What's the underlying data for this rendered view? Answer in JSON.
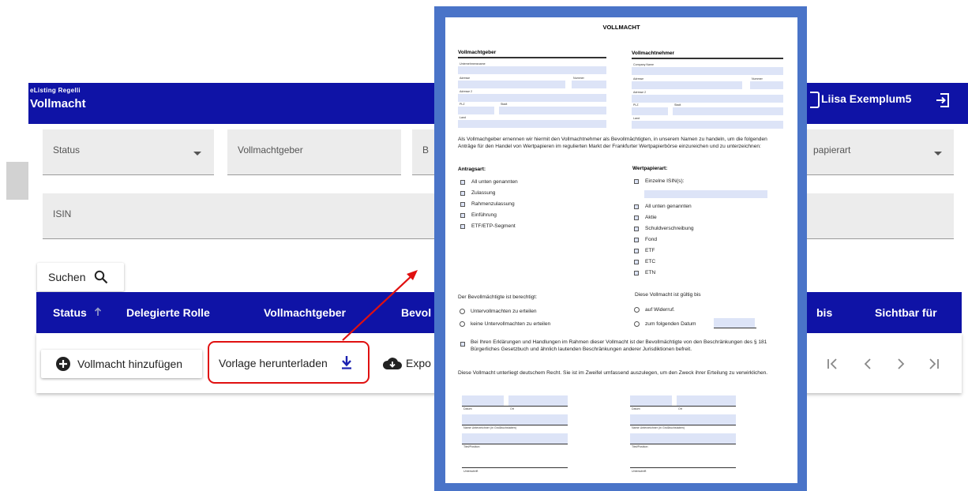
{
  "app": {
    "name": "eListing Regelli",
    "title": "Vollmacht",
    "user": "Liisa Exemplum5"
  },
  "filters": {
    "status": "Status",
    "vollmachtgeber": "Vollmachtgeber",
    "partial_b": "B",
    "wertpapierart_partial": "papierart",
    "isin": "ISIN",
    "search_label": "Suchen"
  },
  "table": {
    "columns": [
      "Status",
      "Delegierte Rolle",
      "Vollmachtgeber",
      "Bevol",
      "bis",
      "Sichtbar für"
    ]
  },
  "actions": {
    "add": "Vollmacht hinzufügen",
    "download": "Vorlage herunterladen",
    "export": "Expo"
  },
  "doc": {
    "title": "VOLLMACHT",
    "giver_heading": "Vollmachtgeber",
    "taker_heading": "Vollmachtnehmer",
    "giver_fields": {
      "company": "Unternehmensname",
      "address": "Adresse",
      "number": "Nummer",
      "address2": "Adresse 2",
      "zip": "PLZ",
      "city": "Stadt",
      "country": "Land"
    },
    "taker_fields": {
      "company": "Company Name",
      "address": "Adresse",
      "number": "Nummer",
      "address2": "Adresse 2",
      "zip": "PLZ",
      "city": "Stadt",
      "country": "Land"
    },
    "intro": "Als Vollmachgeber ernennen wir hiermit den Vollmachtnehmer als Bevollmächtigten, in unserem Namen zu handeln, um die folgenden Anträge für den Handel von Wertpapieren im regulierten Markt der Frankfurter Wertpapierbörse einzureichen und zu unterzeichnen:",
    "antragsart_heading": "Antragsart:",
    "antragsart_items": [
      "All unten genannten",
      "Zulassung",
      "Rahmenzulassung",
      "Einführung",
      "ETF/ETP-Segment"
    ],
    "wertpapierart_heading": "Wertpapierart:",
    "isin_item": "Einzelne ISIN(s):",
    "wertpapierart_items": [
      "All unten genannten",
      "Aktie",
      "Schuldverschreibung",
      "Fond",
      "ETF",
      "ETC",
      "ETN"
    ],
    "berechtigt_heading": "Der Bevollmächtigte ist berechtigt:",
    "berechtigt_items": [
      "Untervollmachten zu erteilen",
      "keine Untervollmachten zu erteilen"
    ],
    "gueltig_heading": "Diese Vollmacht ist gültig bis",
    "gueltig_items": [
      "auf Widerruf.",
      "zum folgenden Datum"
    ],
    "consent": "Bei Ihren Erklärungen und Handlungen im Rahmen dieser Vollmacht ist der Bevollmächtigte von den Beschränkungen des § 181 Bürgerliches Gesetzbuch und ähnlich lautenden Beschränkungen anderer Jurisdiktionen befreit.",
    "law": "Diese Vollmacht unterliegt deutschem Recht. Sie ist im Zweifel umfassend auszulegen, um den Zweck ihrer Erteilung zu verwirklichen.",
    "sig": {
      "date": "Datum",
      "place": "Ort",
      "name": "Name Unterzeichner (in Großbuchstaben)",
      "title": "Titel/Position",
      "signature": "Unterschrift"
    }
  },
  "colors": {
    "header_blue": "#0f13a6",
    "frame_blue": "#4a74c8",
    "highlight_red": "#e01010",
    "field_fill": "#dde4f7"
  }
}
